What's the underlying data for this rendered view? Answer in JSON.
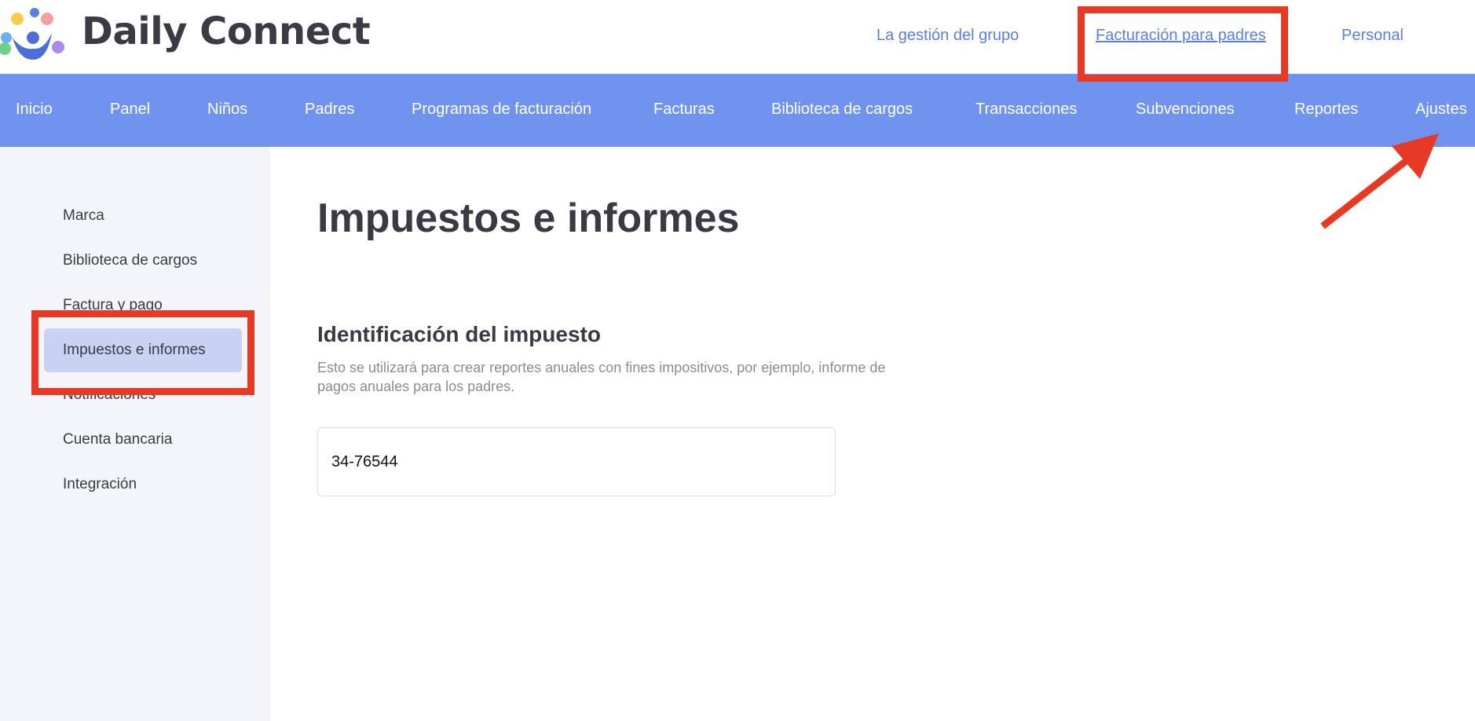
{
  "header": {
    "brand": "Daily Connect",
    "links": [
      {
        "label": "La gestión del grupo"
      },
      {
        "label": "Facturación para padres"
      },
      {
        "label": "Personal"
      }
    ]
  },
  "nav": {
    "items": [
      {
        "label": "Inicio"
      },
      {
        "label": "Panel"
      },
      {
        "label": "Niños"
      },
      {
        "label": "Padres"
      },
      {
        "label": "Programas de facturación"
      },
      {
        "label": "Facturas"
      },
      {
        "label": "Biblioteca de cargos"
      },
      {
        "label": "Transacciones"
      },
      {
        "label": "Subvenciones"
      },
      {
        "label": "Reportes"
      },
      {
        "label": "Ajustes"
      }
    ]
  },
  "sidebar": {
    "items": [
      {
        "label": "Marca"
      },
      {
        "label": "Biblioteca de cargos"
      },
      {
        "label": "Factura y pago"
      },
      {
        "label": "Impuestos e informes"
      },
      {
        "label": "Notificaciones"
      },
      {
        "label": "Cuenta bancaria"
      },
      {
        "label": "Integración"
      }
    ],
    "active_index": 3
  },
  "main": {
    "title": "Impuestos e informes",
    "tax_section": {
      "title": "Identificación del impuesto",
      "description": "Esto se utilizará para crear reportes anuales con fines impositivos, por ejemplo, informe de pagos anuales para los padres.",
      "tax_id_value": "34-76544"
    }
  },
  "colors": {
    "nav_background": "#6f93ee",
    "link": "#5b7fe0",
    "sidebar_background": "#f4f5fa",
    "sidebar_active": "#c9d2f2",
    "annotation": "#e63a24"
  },
  "icons": {
    "logo": "people-logo-icon",
    "annotation_arrow": "arrow-up-right-icon"
  }
}
